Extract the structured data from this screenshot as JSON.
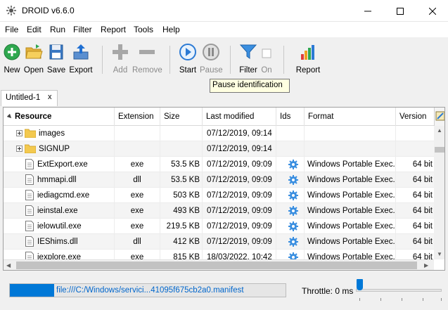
{
  "window": {
    "title": "DROID v6.6.0"
  },
  "menu": [
    "File",
    "Edit",
    "Run",
    "Filter",
    "Report",
    "Tools",
    "Help"
  ],
  "toolbar": {
    "new": "New",
    "open": "Open",
    "save": "Save",
    "export": "Export",
    "add": "Add",
    "remove": "Remove",
    "start": "Start",
    "pause": "Pause",
    "filter": "Filter",
    "on": "On",
    "report": "Report"
  },
  "tooltip": "Pause identification",
  "tab": {
    "label": "Untitled-1",
    "close": "x"
  },
  "grid": {
    "columns": [
      "Resource",
      "Extension",
      "Size",
      "Last modified",
      "Ids",
      "Format",
      "Version"
    ],
    "rows": [
      {
        "type": "folder",
        "name": "images",
        "ext": "",
        "size": "",
        "modified": "07/12/2019, 09:14",
        "ids": false,
        "format": "",
        "version": ""
      },
      {
        "type": "folder",
        "name": "SIGNUP",
        "ext": "",
        "size": "",
        "modified": "07/12/2019, 09:14",
        "ids": false,
        "format": "",
        "version": ""
      },
      {
        "type": "file",
        "name": "ExtExport.exe",
        "ext": "exe",
        "size": "53.5 KB",
        "modified": "07/12/2019, 09:09",
        "ids": true,
        "format": "Windows Portable Exec...",
        "version": "64 bit"
      },
      {
        "type": "file",
        "name": "hmmapi.dll",
        "ext": "dll",
        "size": "53.5 KB",
        "modified": "07/12/2019, 09:09",
        "ids": true,
        "format": "Windows Portable Exec...",
        "version": "64 bit"
      },
      {
        "type": "file",
        "name": "iediagcmd.exe",
        "ext": "exe",
        "size": "503 KB",
        "modified": "07/12/2019, 09:09",
        "ids": true,
        "format": "Windows Portable Exec...",
        "version": "64 bit"
      },
      {
        "type": "file",
        "name": "ieinstal.exe",
        "ext": "exe",
        "size": "493 KB",
        "modified": "07/12/2019, 09:09",
        "ids": true,
        "format": "Windows Portable Exec...",
        "version": "64 bit"
      },
      {
        "type": "file",
        "name": "ielowutil.exe",
        "ext": "exe",
        "size": "219.5 KB",
        "modified": "07/12/2019, 09:09",
        "ids": true,
        "format": "Windows Portable Exec...",
        "version": "64 bit"
      },
      {
        "type": "file",
        "name": "IEShims.dll",
        "ext": "dll",
        "size": "412 KB",
        "modified": "07/12/2019, 09:09",
        "ids": true,
        "format": "Windows Portable Exec...",
        "version": "64 bit"
      },
      {
        "type": "file",
        "name": "iexplore.exe",
        "ext": "exe",
        "size": "815 KB",
        "modified": "18/03/2022, 10:42",
        "ids": true,
        "format": "Windows Portable Exec...",
        "version": "64 bit"
      }
    ]
  },
  "status": {
    "progress_text": "file:///C:/Windows/servici...41095f675cb2a0.manifest",
    "progress_fraction": 0.16,
    "throttle_label": "Throttle: 0 ms",
    "throttle_level": 0
  },
  "colors": {
    "accent": "#0078d7",
    "link": "#0066cc",
    "tooltip_bg": "#ffffe1"
  }
}
